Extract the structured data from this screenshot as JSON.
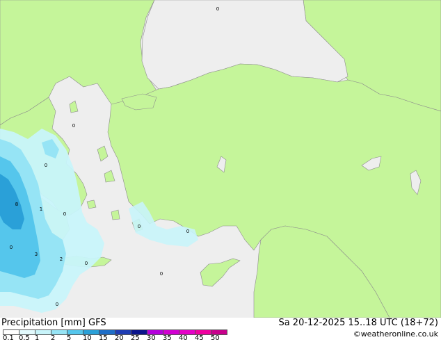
{
  "map": {
    "region": "Eastern Mediterranean - Greece / Aegean / Turkey",
    "colors": {
      "land": "#c5f59a",
      "sea": "#eeeeee",
      "precip_light": "#c8f4fa",
      "precip_medium": "#96e4f5",
      "precip_heavy": "#55c6ec",
      "precip_heavier": "#2aa0d8",
      "border": "#8c8c8c"
    },
    "point_markers": [
      "0",
      "0",
      "0",
      "0",
      "0",
      "0",
      "0",
      "0",
      "0",
      "0",
      "1",
      "2",
      "8",
      "3",
      "0",
      "0"
    ]
  },
  "footer": {
    "title": "Precipitation [mm] GFS",
    "datetime": "Sa 20-12-2025 15..18 UTC (18+72)",
    "credit": "©weatheronline.co.uk"
  },
  "legend": {
    "ticks": [
      "0.1",
      "0.5",
      "1",
      "2",
      "5",
      "10",
      "15",
      "20",
      "25",
      "30",
      "35",
      "40",
      "45",
      "50"
    ],
    "colors": [
      "#ffffff",
      "#e3fafd",
      "#c8f4fa",
      "#96e4f5",
      "#55c6ec",
      "#2aa0d8",
      "#1e6ec8",
      "#1e3cb4",
      "#0a148c",
      "#b400dc",
      "#d200d2",
      "#e600c8",
      "#f000a0",
      "#c8008c"
    ]
  }
}
